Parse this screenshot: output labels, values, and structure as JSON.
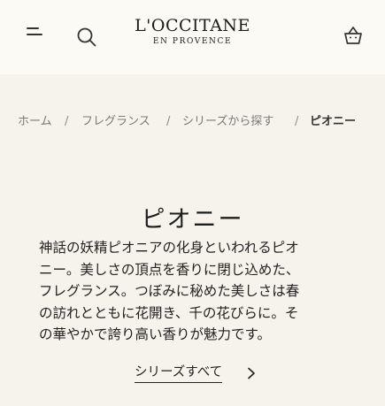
{
  "header": {
    "logo_brand": "L'OCCITANE",
    "logo_tagline": "EN PROVENCE",
    "icons": {
      "menu": "hamburger-menu-icon",
      "search": "search-icon",
      "cart": "shopping-bag-icon"
    }
  },
  "breadcrumb": {
    "items": [
      "ホーム",
      "フレグランス",
      "シリーズから探す",
      "ピオニー"
    ],
    "separator": "/"
  },
  "main": {
    "title": "ピオニー",
    "description_lines": [
      "神話の妖精ピオニアの化身といわれるピオ",
      "ニー。美しさの頂点を香りに閉じ込めた、",
      "フレグランス。つぼみに秘めた美しさは春",
      "の訪れとともに花開き、千の花びらに。そ",
      "の華やかで誇り高い香りが魅力です。"
    ],
    "more_link": "シリーズすべて",
    "more_icon": "chevron-right-icon"
  },
  "colors": {
    "header_bg": "#fcfaf5",
    "page_bg": "#f6f3ed",
    "text": "#222222",
    "muted_text": "#7a7a7a"
  }
}
